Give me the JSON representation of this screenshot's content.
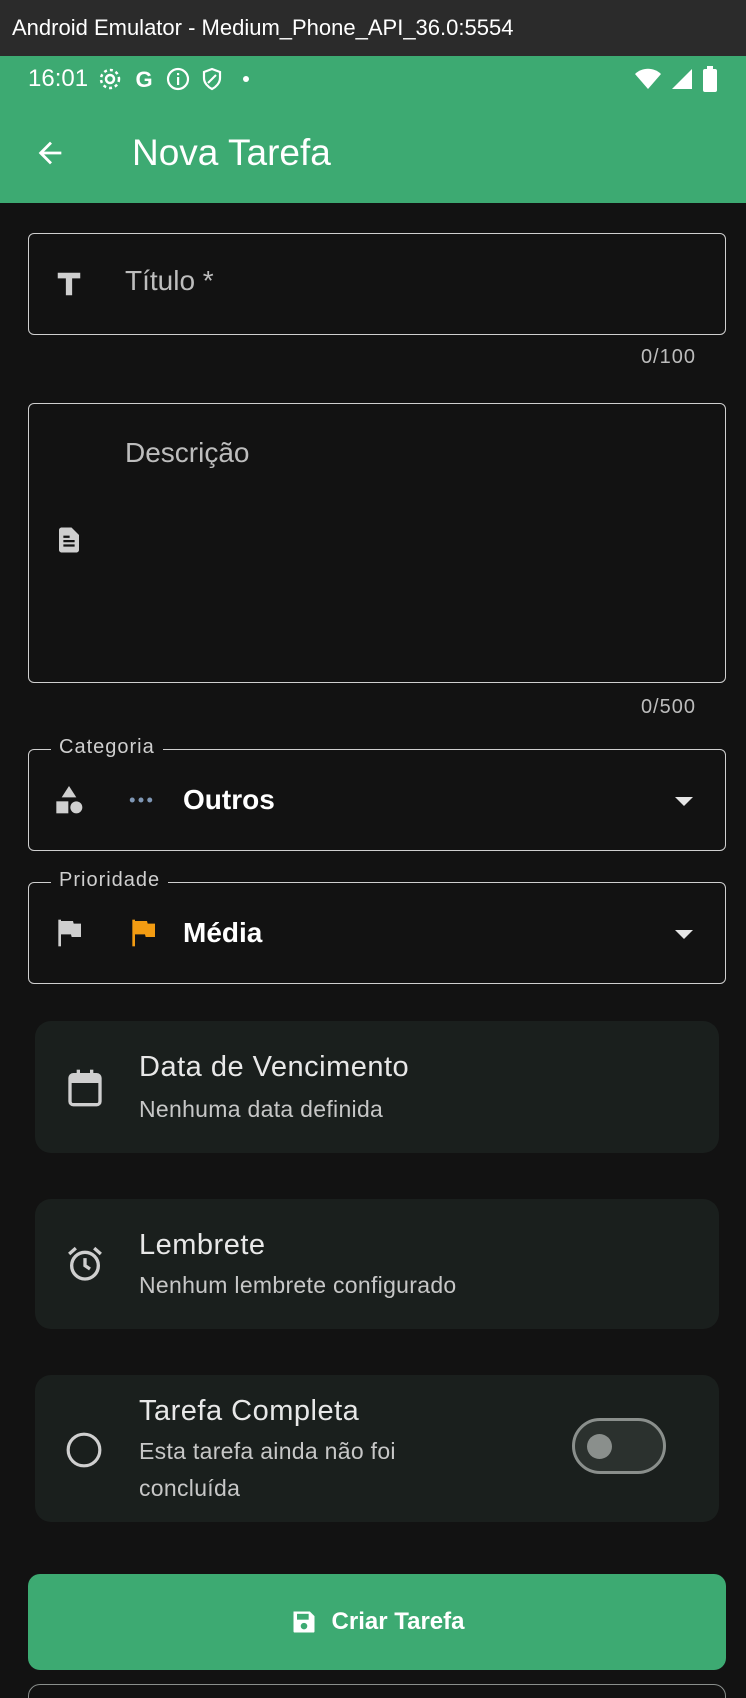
{
  "window": {
    "title": "Android Emulator - Medium_Phone_API_36.0:5554"
  },
  "status_bar": {
    "time": "16:01",
    "icons_left": [
      "settings-icon",
      "google-icon",
      "info-icon",
      "shield-icon",
      "dot-icon"
    ],
    "icons_right": [
      "wifi-icon",
      "signal-icon",
      "battery-icon"
    ]
  },
  "app_bar": {
    "title": "Nova Tarefa",
    "back_icon": "arrow-back-icon"
  },
  "form": {
    "title_field": {
      "placeholder": "Título *",
      "counter": "0/100",
      "icon": "text-format-icon"
    },
    "description_field": {
      "placeholder": "Descrição",
      "counter": "0/500",
      "icon": "description-icon"
    },
    "category_field": {
      "label": "Categoria",
      "value": "Outros",
      "icon": "category-icon",
      "value_icon": "more-horiz-icon"
    },
    "priority_field": {
      "label": "Prioridade",
      "value": "Média",
      "icon": "flag-icon",
      "value_icon": "flag-icon",
      "value_icon_color": "#f39c12"
    }
  },
  "cards": {
    "due_date": {
      "title": "Data de Vencimento",
      "subtitle": "Nenhuma data definida",
      "icon": "calendar-icon"
    },
    "reminder": {
      "title": "Lembrete",
      "subtitle": "Nenhum lembrete configurado",
      "icon": "alarm-icon"
    },
    "complete": {
      "title": "Tarefa Completa",
      "subtitle": "Esta tarefa ainda não foi concluída",
      "icon": "radio-unchecked-icon",
      "toggle_on": false
    }
  },
  "actions": {
    "create_label": "Criar Tarefa",
    "create_icon": "save-icon"
  },
  "colors": {
    "primary": "#3daa72",
    "background": "#121212",
    "card": "#1a1f1d",
    "accent_orange": "#f39c12"
  }
}
